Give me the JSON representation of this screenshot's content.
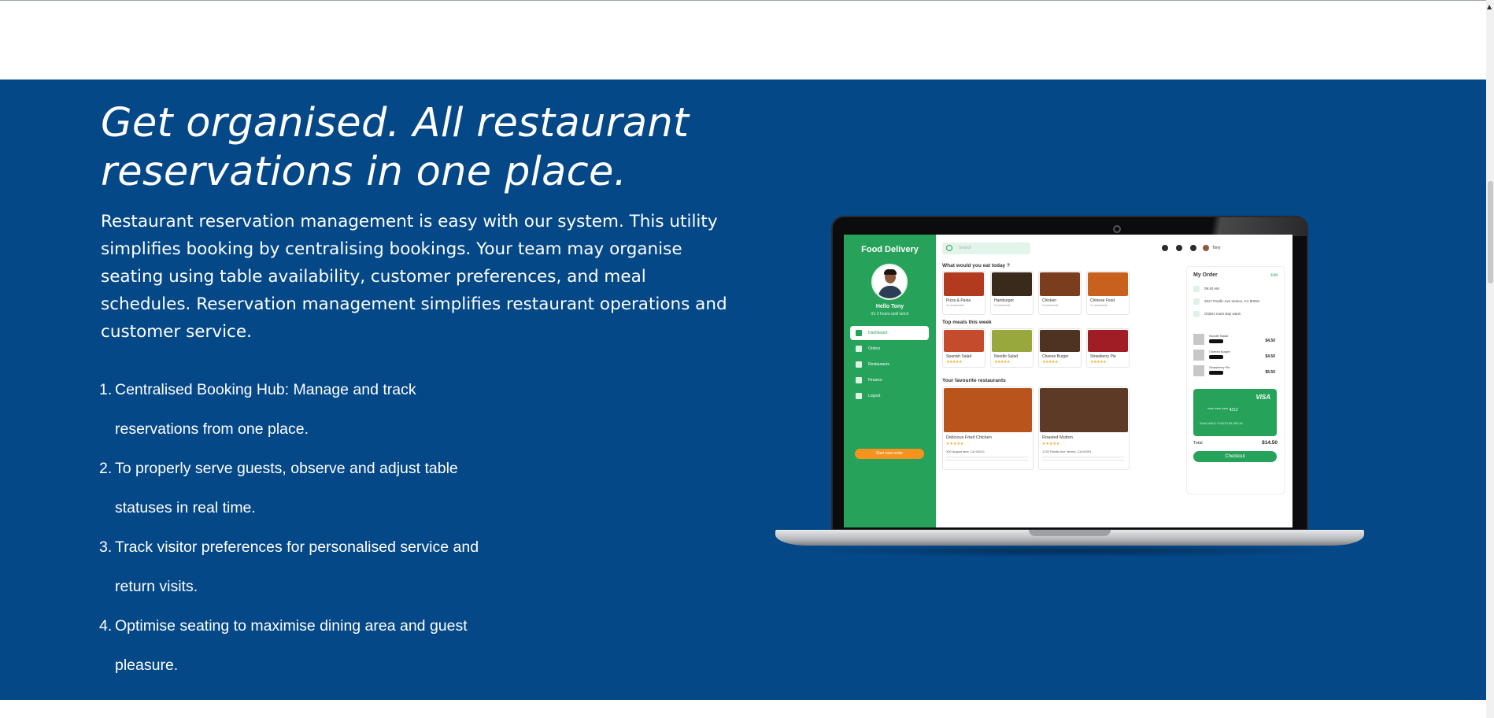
{
  "hero": {
    "title": "Get organised. All restaurant reservations in one place.",
    "intro": "Restaurant reservation management is easy with our system. This utility simplifies booking by centralising bookings. Your team may organise seating using table availability, customer preferences, and meal schedules. Reservation management simplifies restaurant operations and customer service."
  },
  "features": [
    {
      "num": "1.",
      "line1": "Centralised Booking Hub: Manage and track",
      "line2": "reservations from one place."
    },
    {
      "num": "2.",
      "line1": "To properly serve guests, observe and adjust table",
      "line2": "statuses in real time."
    },
    {
      "num": "3.",
      "line1": "Track visitor preferences for personalised service and",
      "line2": "return visits."
    },
    {
      "num": "4.",
      "line1": "Optimise seating to maximise dining area and guest",
      "line2": "pleasure."
    }
  ],
  "laptop_screen": {
    "sidebar": {
      "title": "Food Delivery",
      "greeting": "Hello Tony",
      "subtitle": "it's 2 hours until lunch",
      "nav": [
        "Dashboard",
        "Orders",
        "Restaurants",
        "Finance",
        "Logout"
      ],
      "cta": "Start new order"
    },
    "search_placeholder": "Search",
    "user_name": "Tony",
    "section_today": "What would you eat today ?",
    "categories": [
      {
        "name": "Pizza & Pasta",
        "sub": "12 restaurants",
        "color": "#b23a1e"
      },
      {
        "name": "Hamburger",
        "sub": "8 restaurants",
        "color": "#3a2a1c"
      },
      {
        "name": "Chicken",
        "sub": "6 restaurants",
        "color": "#7a3d1d"
      },
      {
        "name": "Chinese Food",
        "sub": "11 restaurants",
        "color": "#c8611e"
      }
    ],
    "section_top": "Top meals this week",
    "meals": [
      {
        "name": "Spanish Salad",
        "stars": "★★★★★",
        "color": "#c44b2c"
      },
      {
        "name": "Noodle Salad",
        "stars": "★★★★★",
        "color": "#98a83c"
      },
      {
        "name": "Cheese Burger",
        "stars": "★★★★★",
        "color": "#4e3320"
      },
      {
        "name": "Strawberry Pie",
        "stars": "★★★★★",
        "color": "#a11d25"
      }
    ],
    "section_fav": "Your favourite restaurants",
    "restaurants": [
      {
        "name": "Delicious Fried Chicken",
        "stars": "★★★★★",
        "address": "300 August lane, CA 90210",
        "color": "#b9541c"
      },
      {
        "name": "Roasted Mutton",
        "stars": "★★★★★",
        "address": "1720 Pacific Ave Venice, CA 90291",
        "color": "#5c3a25"
      }
    ],
    "order": {
      "title": "My Order",
      "edit": "Edit",
      "time": "09:40 AM",
      "address": "2517 Pacific Ave Venice, CA 90291",
      "note": "Orders must stay warm",
      "items": [
        {
          "name": "Noodle Salad",
          "price": "$4.50"
        },
        {
          "name": "Cheese Burger",
          "price": "$4.50"
        },
        {
          "name": "Strawberry Pie",
          "price": "$5.50"
        }
      ],
      "card_brand": "VISA",
      "card_number": "**** **** **** 4212",
      "card_meta": "AVAILABLE FUNDS  $4,983.50",
      "total_label": "Total",
      "total_value": "$14.50",
      "checkout": "Checkout"
    }
  },
  "colors": {
    "band": "#044888",
    "app_green": "#27a25a",
    "cta_orange": "#f6931e"
  }
}
